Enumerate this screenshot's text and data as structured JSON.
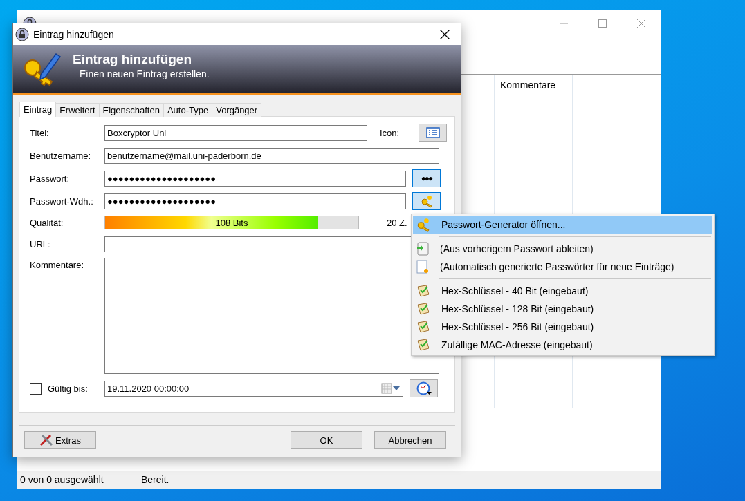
{
  "background_window": {
    "list_columns": [
      "Kommentare"
    ],
    "status_bar": [
      "0 von 0 ausgewählt",
      "Bereit."
    ]
  },
  "dialog": {
    "title": "Eintrag hinzufügen",
    "banner": {
      "title": "Eintrag hinzufügen",
      "subtitle": "Einen neuen Eintrag erstellen."
    },
    "tabs": [
      {
        "label": "Eintrag",
        "selected": true
      },
      {
        "label": "Erweitert",
        "selected": false
      },
      {
        "label": "Eigenschaften",
        "selected": false
      },
      {
        "label": "Auto-Type",
        "selected": false
      },
      {
        "label": "Vorgänger",
        "selected": false
      }
    ],
    "fields": [
      {
        "kind": "title",
        "label": "Titel:",
        "value": "Boxcryptor Uni",
        "side_label": "Icon:"
      },
      {
        "kind": "text",
        "label": "Benutzername:",
        "value": "benutzername@mail.uni-paderborn.de"
      },
      {
        "kind": "password",
        "label": "Passwort:",
        "value": "●●●●●●●●●●●●●●●●●●●●",
        "button": "●●●",
        "pressed": true
      },
      {
        "kind": "repeat",
        "label": "Passwort-Wdh.:",
        "value": "●●●●●●●●●●●●●●●●●●●●",
        "pressed": true
      },
      {
        "kind": "quality",
        "label": "Qualität:",
        "level": 0.84,
        "reading": "108 Bits",
        "count": "20 Z."
      },
      {
        "kind": "text",
        "label": "URL:"
      },
      {
        "kind": "multiline",
        "label": "Kommentare:"
      }
    ],
    "expiry": {
      "label": "Gültig bis:",
      "checked": false,
      "value": "19.11.2020 00:00:00"
    },
    "buttons": {
      "extras": "Extras",
      "ok": "OK",
      "cancel": "Abbrechen"
    }
  },
  "menu": {
    "groups": [
      [
        {
          "kind": "generator",
          "label": "Passwort-Generator öffnen...",
          "selected": true
        }
      ],
      [
        {
          "kind": "derive",
          "label": "(Aus vorherigem Passwort ableiten)",
          "selected": false
        },
        {
          "kind": "auto",
          "label": "(Automatisch generierte Passwörter für neue Einträge)",
          "selected": false
        }
      ],
      [
        {
          "kind": "profile",
          "label": "Hex-Schlüssel - 40 Bit (eingebaut)",
          "selected": false
        },
        {
          "kind": "profile",
          "label": "Hex-Schlüssel - 128 Bit (eingebaut)",
          "selected": false
        },
        {
          "kind": "profile",
          "label": "Hex-Schlüssel - 256 Bit (eingebaut)",
          "selected": false
        },
        {
          "kind": "profile",
          "label": "Zufällige MAC-Adresse (eingebaut)",
          "selected": false
        }
      ]
    ]
  }
}
